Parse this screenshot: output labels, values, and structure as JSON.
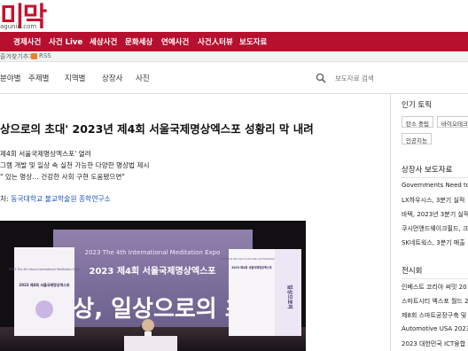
{
  "brand": {
    "logo_text": "미막",
    "logo_url": "agunin.com"
  },
  "top_nav": [
    "경제사건",
    "사건 Live",
    "세상사건",
    "문화세상",
    "연예사건",
    "사건人터뷰",
    "보도자료"
  ],
  "subbar": {
    "bookmark": "즐겨찾기추가",
    "rss": "RSS"
  },
  "section_nav": [
    "분야별",
    "주제별",
    "지역별",
    "상장사",
    "사진"
  ],
  "search": {
    "placeholder": "보도자료 검색"
  },
  "article": {
    "headline": "상으로의 초대' 2023년 제4회 서울국제명상엑스포 성황리 막 내려",
    "summary": [
      "제4회 서울국제명상엑스포' 열려",
      "그램 개발 및 일상 속 실천 가능한 다양한 명상법 제시",
      "\" 있는 명상… 건강한 사회 구현 도움됐으면\""
    ],
    "source_label": "처:",
    "source_name": "동국대학교 불교학술원 종학연구소",
    "photo": {
      "banner_main": "명상, 일상으로의 초대",
      "banner_sub": "2023 제4회 서울국제명상엑스포",
      "banner_en": "2023 The 4th International Meditation Expo",
      "left_poster_en": "2023 The 4th Seoul International Meditation Expo",
      "left_poster_kr": "2023 제4회 서울국제명상엑스포",
      "right_poster_en": "2023 The 4th Seoul International Meditation Expo",
      "right_poster_kr": "2023 제4회 서울국제명상엑스포",
      "right_poster_big": "일상으로의"
    }
  },
  "sidebar": {
    "popular_title": "인기 토픽",
    "popular_tags": [
      "탄소 중립",
      "바이오테크",
      "인공지능"
    ],
    "listed_title": "상장사 보도자료",
    "listed_items": [
      "Governments Need to",
      "LX하우시스, 3분기 실적",
      "바텍, 2023년 3분기 실적",
      "쿠시먼앤드웨이크필드, 크",
      "SK네트웍스, 3분기 매출"
    ],
    "exhibition_title": "전시회",
    "exhibition_items": [
      "인베스트 코리아 써밋 20",
      "스마트시티 엑스포 월드 2",
      "제8회 스마트공장구축 및",
      "Automotive USA 2023",
      "2023 대한민국 ICT융합"
    ]
  },
  "colors": {
    "brand_red": "#b7102f",
    "link_blue": "#1a55b8"
  }
}
